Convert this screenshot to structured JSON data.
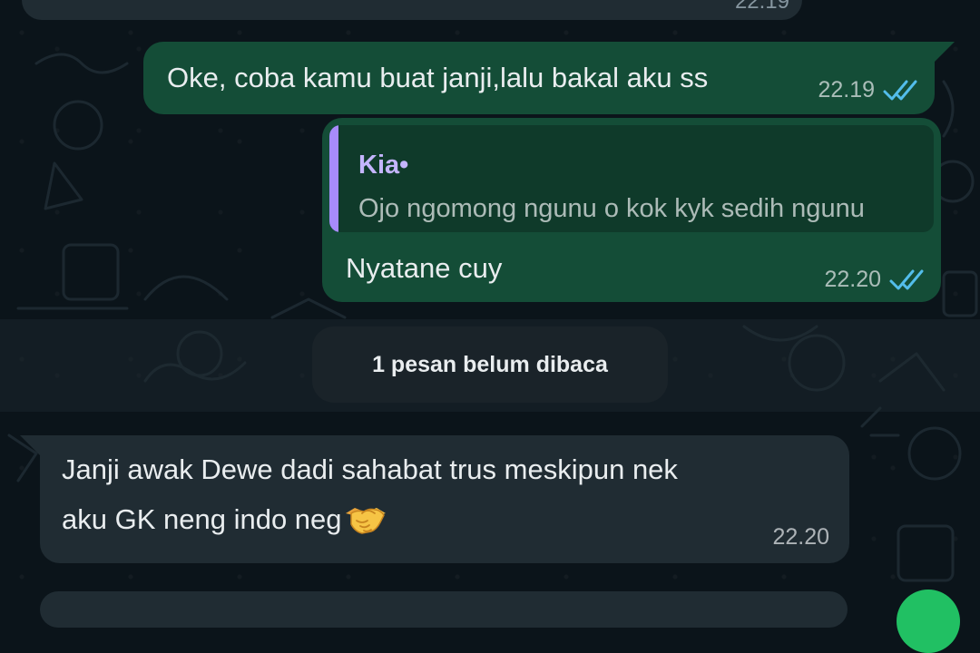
{
  "chat": {
    "previous_message": {
      "time": "22.19"
    },
    "messages": [
      {
        "direction": "outgoing",
        "text": "Oke, coba kamu buat janji,lalu bakal aku ss",
        "time": "22.19",
        "status": "read"
      },
      {
        "direction": "outgoing",
        "reply_to": {
          "sender": "Kia•",
          "text": "Ojo ngomong ngunu o kok kyk sedih ngunu"
        },
        "text": "Nyatane cuy",
        "time": "22.20",
        "status": "read"
      },
      {
        "direction": "incoming",
        "text_line1": "Janji awak Dewe dadi sahabat trus meskipun nek",
        "text_line2": "aku GK neng indo neg",
        "emoji": "handshake-emoji",
        "time": "22.20"
      }
    ],
    "unread_divider": "1 pesan belum dibaca"
  },
  "icons": {
    "read_receipt": "double-check-icon",
    "read_color": "#53bdeb"
  },
  "colors": {
    "background": "#0b141a",
    "outgoing_bubble": "#144d37",
    "incoming_bubble": "#202c33",
    "reply_accent": "#a78bfa",
    "fab": "#21c063"
  }
}
